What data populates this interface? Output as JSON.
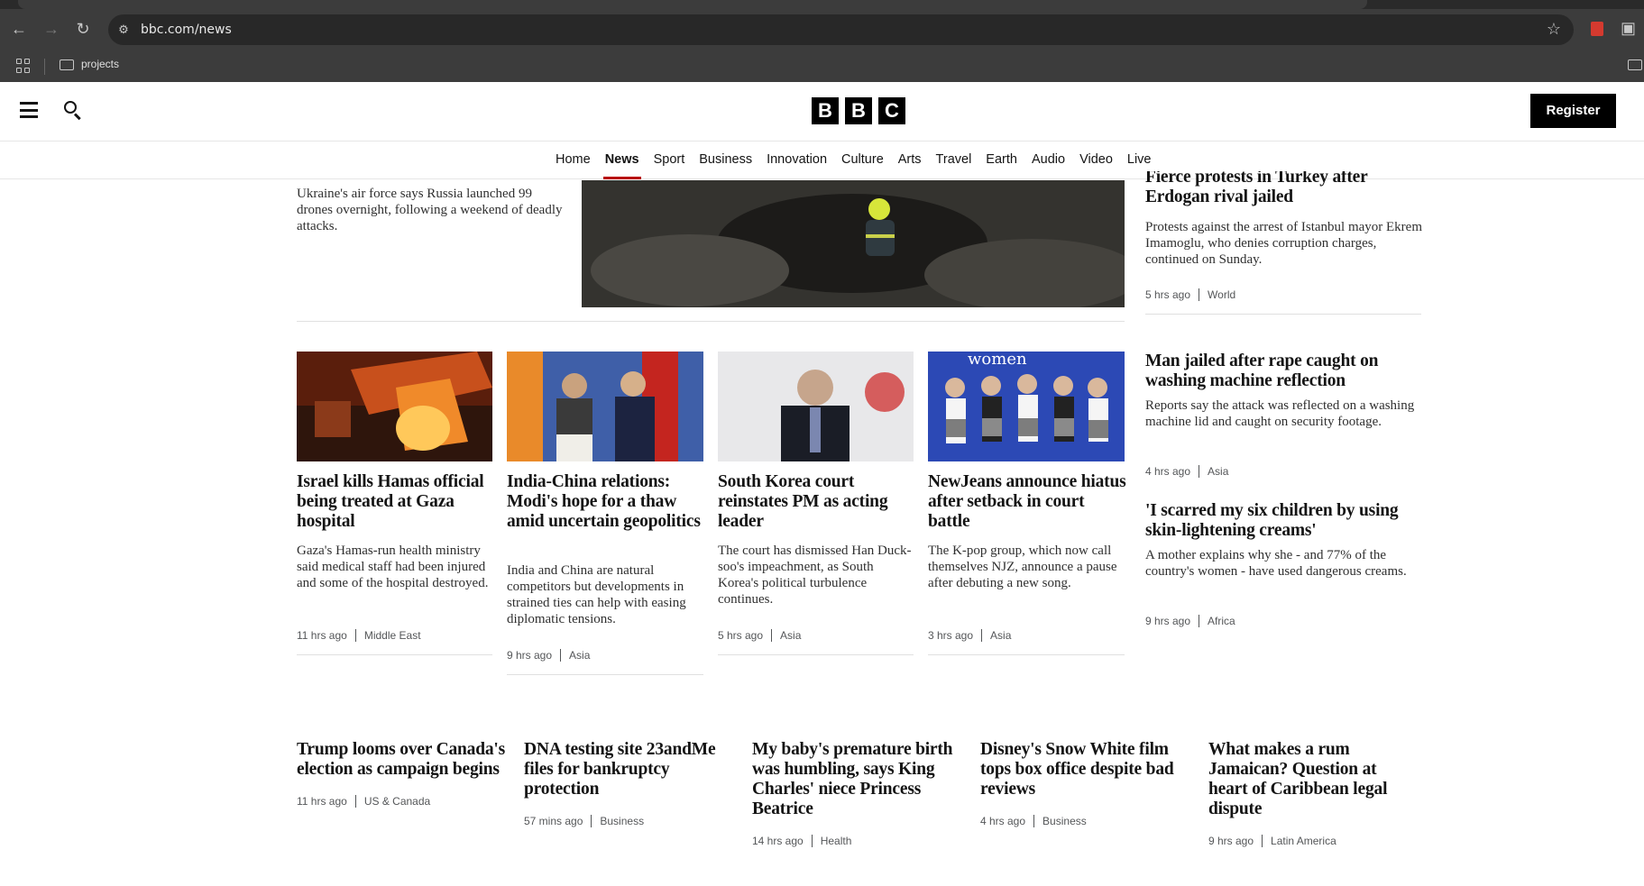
{
  "browser": {
    "url": "bbc.com/news",
    "bookmark_folder": "projects"
  },
  "header": {
    "logo_letters": [
      "B",
      "B",
      "C"
    ],
    "register_label": "Register"
  },
  "nav": {
    "items": [
      "Home",
      "News",
      "Sport",
      "Business",
      "Innovation",
      "Culture",
      "Arts",
      "Travel",
      "Earth",
      "Audio",
      "Video",
      "Live"
    ],
    "active": "News"
  },
  "top": {
    "left_summary": "Ukraine's air force says Russia launched 99 drones overnight, following a weekend of deadly attacks.",
    "right_story": {
      "headline_line1": "Fierce protests in Turkey after",
      "headline_line2": "Erdogan rival jailed",
      "summary": "Protests against the arrest of Istanbul mayor Ekrem Imamoglu, who denies corruption charges, continued on Sunday.",
      "time": "5 hrs ago",
      "section": "World"
    }
  },
  "cards": [
    {
      "headline": "Israel kills Hamas official being treated at Gaza hospital",
      "summary": "Gaza's Hamas-run health ministry said medical staff had been injured and some of the hospital destroyed.",
      "time": "11 hrs ago",
      "section": "Middle East"
    },
    {
      "headline": "India-China relations: Modi's hope for a thaw amid uncertain geopolitics",
      "summary": "India and China are natural competitors but developments in strained ties can help with easing diplomatic tensions.",
      "time": "9 hrs ago",
      "section": "Asia"
    },
    {
      "headline": "South Korea court reinstates PM as acting leader",
      "summary": "The court has dismissed Han Duck-soo's impeachment, as South Korea's political turbulence continues.",
      "time": "5 hrs ago",
      "section": "Asia"
    },
    {
      "headline": "NewJeans announce hiatus after setback in court battle",
      "summary": "The K-pop group, which now call themselves NJZ, announce a pause after debuting a new song.",
      "time": "3 hrs ago",
      "section": "Asia",
      "image_text": "women"
    }
  ],
  "right_column": [
    {
      "headline": "Man jailed after rape caught on washing machine reflection",
      "summary": "Reports say the attack was reflected on a washing machine lid and caught on security footage.",
      "time": "4 hrs ago",
      "section": "Asia"
    },
    {
      "headline": "'I scarred my six children by using skin-lightening creams'",
      "summary": "A mother explains why she - and 77% of the country's women - have used dangerous creams.",
      "time": "9 hrs ago",
      "section": "Africa"
    }
  ],
  "bottom_row": [
    {
      "headline": "Trump looms over Canada's election as campaign begins",
      "time": "11 hrs ago",
      "section": "US & Canada"
    },
    {
      "headline": "DNA testing site 23andMe files for bankruptcy protection",
      "time": "57 mins ago",
      "section": "Business"
    },
    {
      "headline": "My baby's premature birth was humbling, says King Charles' niece Princess Beatrice",
      "time": "14 hrs ago",
      "section": "Health"
    },
    {
      "headline": "Disney's Snow White film tops box office despite bad reviews",
      "time": "4 hrs ago",
      "section": "Business"
    },
    {
      "headline": "What makes a rum Jamaican? Question at heart of Caribbean legal dispute",
      "time": "9 hrs ago",
      "section": "Latin America"
    }
  ]
}
